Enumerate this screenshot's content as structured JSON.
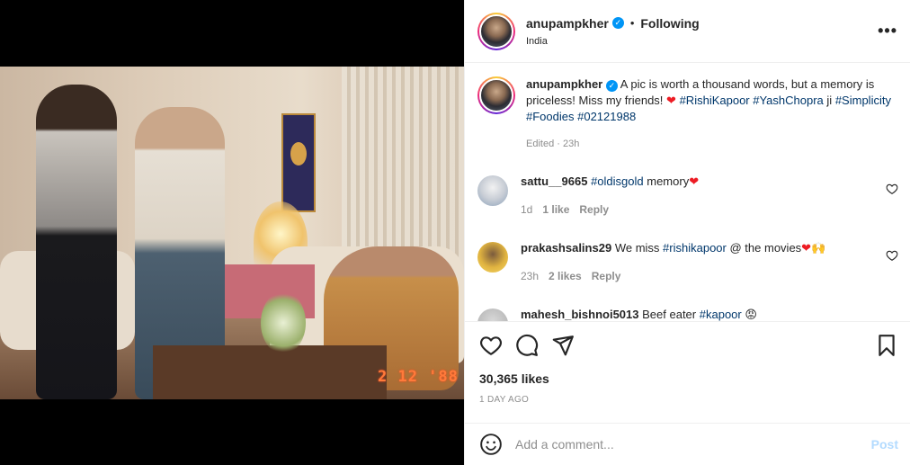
{
  "post": {
    "username": "anupampkher",
    "follow_separator": "•",
    "follow_label": "Following",
    "location": "India",
    "more_icon": "more-horizontal-icon",
    "photo_date_stamp": "2 12 '88"
  },
  "caption": {
    "username": "anupampkher",
    "text_pre": "A pic is worth a thousand words, but a memory is priceless! Miss my friends!",
    "heart": "❤",
    "tag1": "#RishiKapoor",
    "tag2": "#YashChopra",
    "text_mid": "ji",
    "tag3": "#Simplicity",
    "tag4": "#Foodies",
    "tag5": "#02121988",
    "meta": "Edited · 23h"
  },
  "comments": [
    {
      "username": "sattu__9665",
      "tag": "#oldisgold",
      "text": "memory",
      "emoji": "❤",
      "time": "1d",
      "likes": "1 like",
      "reply": "Reply"
    },
    {
      "username": "prakashsalins29",
      "text_pre": "We miss",
      "tag": "#rishikapoor",
      "text_post": "@ the movies",
      "emoji": "❤🙌",
      "time": "23h",
      "likes": "2 likes",
      "reply": "Reply"
    },
    {
      "username": "mahesh_bishnoi5013",
      "text": "Beef eater",
      "tag": "#kapoor",
      "emoji": "😡"
    }
  ],
  "actions": {
    "likes_count": "30,365 likes",
    "time_ago": "1 DAY AGO"
  },
  "add_comment": {
    "placeholder": "Add a comment...",
    "post_label": "Post"
  },
  "colors": {
    "link": "#00376b",
    "verified": "#0095f6",
    "post_disabled": "#b3dbff",
    "heart": "#ed1c24"
  }
}
